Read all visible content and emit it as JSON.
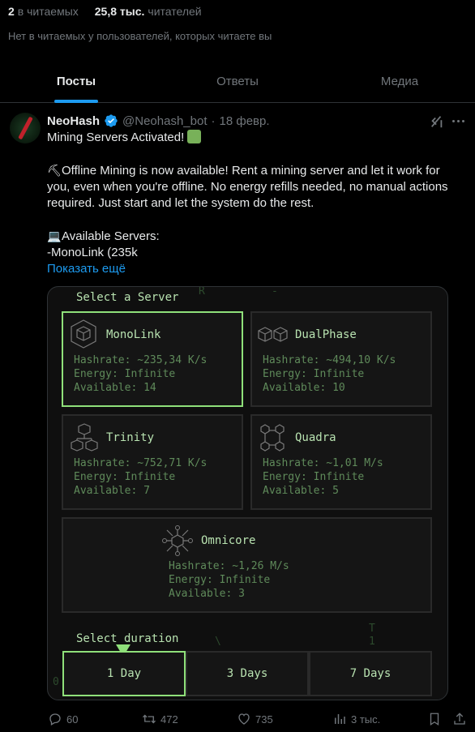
{
  "profile_stats": {
    "reading_count": "2",
    "reading_label": "в читаемых",
    "followers_count": "25,8 тыс.",
    "followers_label": "читателей",
    "mutual_note": "Нет в читаемых у пользователей, которых читаете вы"
  },
  "tabs": [
    {
      "label": "Посты",
      "active": true
    },
    {
      "label": "Ответы",
      "active": false
    },
    {
      "label": "Медиа",
      "active": false
    }
  ],
  "post": {
    "author_name": "NeoHash",
    "handle": "@Neohash_bot",
    "separator": "·",
    "date": "18 февр.",
    "line1": "Mining Servers Activated!",
    "paragraph": "Offline Mining is now available! Rent a mining server and let it work for you, even when you're offline. No energy refills needed, no manual actions required. Just start and let the system do the rest.",
    "servers_heading": "Available Servers:",
    "servers_line": "-MonoLink (235k",
    "show_more": "Показать ещё"
  },
  "media": {
    "select_server": "Select a Server",
    "select_duration": "Select duration",
    "servers": [
      {
        "name": "MonoLink",
        "hashrate": "Hashrate: ~235,34 K/s",
        "energy": "Energy: Infinite",
        "available": "Available: 14",
        "selected": true,
        "icon": "hexagon-cube-icon"
      },
      {
        "name": "DualPhase",
        "hashrate": "Hashrate: ~494,10 K/s",
        "energy": "Energy: Infinite",
        "available": "Available: 10",
        "selected": false,
        "icon": "double-cube-icon"
      },
      {
        "name": "Trinity",
        "hashrate": "Hashrate: ~752,71 K/s",
        "energy": "Energy: Infinite",
        "available": "Available: 7",
        "selected": false,
        "icon": "triple-cube-icon"
      },
      {
        "name": "Quadra",
        "hashrate": "Hashrate: ~1,01 M/s",
        "energy": "Energy: Infinite",
        "available": "Available: 5",
        "selected": false,
        "icon": "quad-cube-icon"
      },
      {
        "name": "Omnicore",
        "hashrate": "Hashrate: ~1,26 M/s",
        "energy": "Energy: Infinite",
        "available": "Available: 3",
        "selected": false,
        "icon": "network-cube-icon"
      }
    ],
    "durations": [
      {
        "label": "1 Day",
        "selected": true
      },
      {
        "label": "3 Days",
        "selected": false
      },
      {
        "label": "7 Days",
        "selected": false
      }
    ],
    "bg_glyphs": [
      "R",
      "-",
      "T",
      "1",
      "\\",
      "0"
    ]
  },
  "actions": {
    "replies": "60",
    "reposts": "472",
    "likes": "735",
    "views": "3 тыс."
  },
  "colors": {
    "accent": "#1d9bf0",
    "terminal_green": "#8fe07a",
    "muted": "#71767b"
  }
}
